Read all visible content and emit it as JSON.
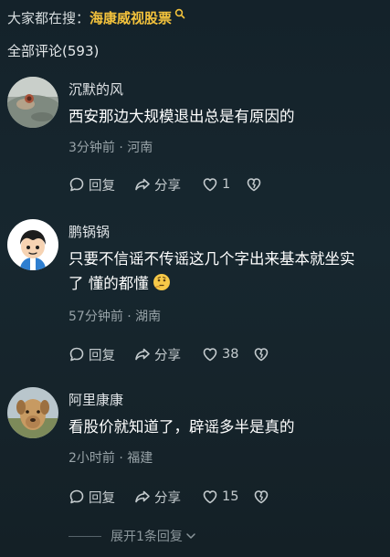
{
  "search": {
    "prefix": "大家都在搜：",
    "term": "海康威视股票"
  },
  "comments_header": {
    "count_label": "全部评论(593)"
  },
  "comments": [
    {
      "author": "沉默的风",
      "text": "西安那边大规模退出总是有原因的",
      "meta": "3分钟前 · 河南",
      "reply_label": "回复",
      "share_label": "分享",
      "likes": "1",
      "avatar_icon": "nature-photo-avatar"
    },
    {
      "author": "鹏锅锅",
      "text_line1": "只要不信谣不传谣这几个字出来基本就坐实",
      "text_line2": "了 懂的都懂",
      "emoji_icon": "thinking-emoji-icon",
      "meta": "57分钟前 · 湖南",
      "reply_label": "回复",
      "share_label": "分享",
      "likes": "38",
      "avatar_icon": "cartoon-boy-avatar"
    },
    {
      "author": "阿里康康",
      "text": "看股价就知道了，辟谣多半是真的",
      "meta": "2小时前 · 福建",
      "reply_label": "回复",
      "share_label": "分享",
      "likes": "15",
      "avatar_icon": "dog-photo-avatar"
    }
  ],
  "expand_replies": {
    "label": "展开1条回复"
  },
  "colors": {
    "search_term": "#f3c23c",
    "background": "#17272f",
    "secondary_text": "#98a3a8"
  }
}
